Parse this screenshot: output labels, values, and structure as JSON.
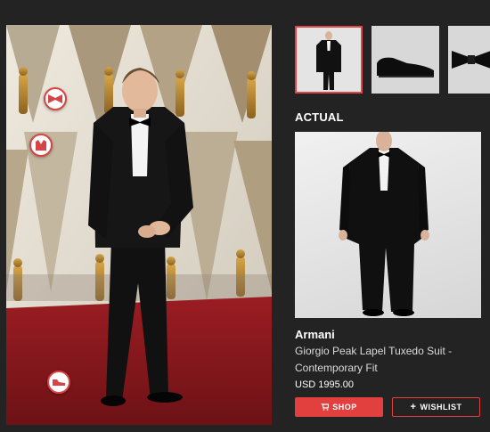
{
  "gallery": {
    "main_photo_alt": "Man in black tuxedo on red carpet",
    "hotspots": [
      {
        "name": "bowtie-hotspot",
        "icon": "bowtie-icon"
      },
      {
        "name": "jacket-hotspot",
        "icon": "jacket-icon"
      },
      {
        "name": "shoe-hotspot",
        "icon": "shoe-icon"
      }
    ]
  },
  "thumbnails": [
    {
      "icon": "tuxedo-thumb",
      "active": true
    },
    {
      "icon": "shoe-thumb",
      "active": false
    },
    {
      "icon": "bowtie-thumb",
      "active": false
    }
  ],
  "product": {
    "section_label": "ACTUAL",
    "brand": "Armani",
    "name": "Giorgio Peak Lapel Tuxedo Suit - Contemporary Fit",
    "price": "USD 1995.00"
  },
  "actions": {
    "shop_label": "SHOP",
    "wishlist_label": "WISHLIST"
  },
  "colors": {
    "background": "#232323",
    "accent": "#e23f3f",
    "carpet": "#8c1a1f"
  }
}
